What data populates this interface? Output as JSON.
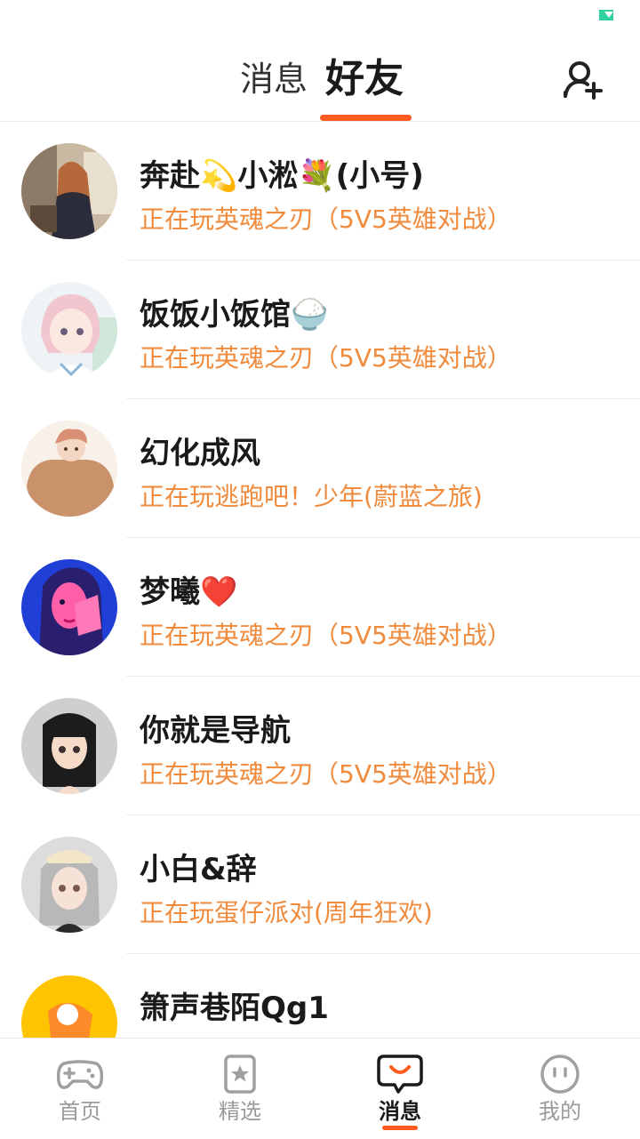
{
  "header": {
    "tab_messages": "消息",
    "tab_friends": "好友",
    "active_tab": "好友",
    "add_friend_icon": "add-person-icon"
  },
  "friends": [
    {
      "name": "奔赴💫小淞💐(小号)",
      "status": "正在玩英魂之刃（5V5英雄对战）"
    },
    {
      "name": "饭饭小饭馆🍚",
      "status": "正在玩英魂之刃（5V5英雄对战）"
    },
    {
      "name": "幻化成风",
      "status": "正在玩逃跑吧！少年(蔚蓝之旅)"
    },
    {
      "name": "梦曦❤️",
      "status": "正在玩英魂之刃（5V5英雄对战）"
    },
    {
      "name": "你就是导航",
      "status": "正在玩英魂之刃（5V5英雄对战）"
    },
    {
      "name": "小白&辞",
      "status": "正在玩蛋仔派对(周年狂欢)"
    },
    {
      "name": "箫声巷陌Qg1",
      "status": ""
    }
  ],
  "bottom_nav": {
    "items": [
      {
        "label": "首页",
        "icon": "gamepad-icon"
      },
      {
        "label": "精选",
        "icon": "star-card-icon"
      },
      {
        "label": "消息",
        "icon": "chat-bubble-icon"
      },
      {
        "label": "我的",
        "icon": "face-icon"
      }
    ],
    "active": "消息"
  },
  "colors": {
    "accent": "#ff5a1f",
    "status_text": "#f08a3c",
    "battery": "#2fd3a0"
  }
}
